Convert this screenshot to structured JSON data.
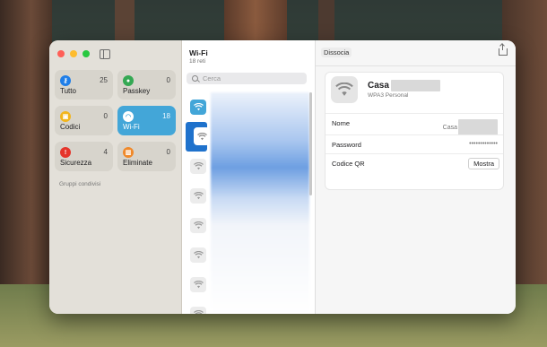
{
  "sidebar": {
    "tiles": [
      {
        "label": "Tutto",
        "count": "25",
        "icon": "key-icon",
        "icon_glyph": "⚷",
        "color": "#1f7ee8"
      },
      {
        "label": "Passkey",
        "count": "0",
        "icon": "person-icon",
        "icon_glyph": "●",
        "color": "#34a853"
      },
      {
        "label": "Codici",
        "count": "0",
        "icon": "lock-icon",
        "icon_glyph": "▣",
        "color": "#f2b51c"
      },
      {
        "label": "Wi-Fi",
        "count": "18",
        "icon": "wifi-icon",
        "icon_glyph": "◠",
        "color": "#43a6d8",
        "selected": true
      },
      {
        "label": "Sicurezza",
        "count": "4",
        "icon": "alert-icon",
        "icon_glyph": "!",
        "color": "#e5352b"
      },
      {
        "label": "Eliminate",
        "count": "0",
        "icon": "trash-icon",
        "icon_glyph": "▥",
        "color": "#f0892a"
      }
    ],
    "shared_groups_label": "Gruppi condivisi"
  },
  "list": {
    "title": "Wi-Fi",
    "subtitle": "18 reti",
    "search_placeholder": "Cerca",
    "network_count_visible": 8
  },
  "detail": {
    "toolbar": {
      "dissociate_label": "Dissocia"
    },
    "network": {
      "name": "Casa",
      "security": "WPA3 Personal"
    },
    "fields": {
      "name_label": "Nome",
      "name_value": "Casa",
      "password_label": "Password",
      "password_value": "•••••••••••••",
      "qr_label": "Codice QR",
      "qr_button": "Mostra"
    }
  },
  "colors": {
    "accent": "#43a6d8",
    "selection": "#1f72cc"
  }
}
